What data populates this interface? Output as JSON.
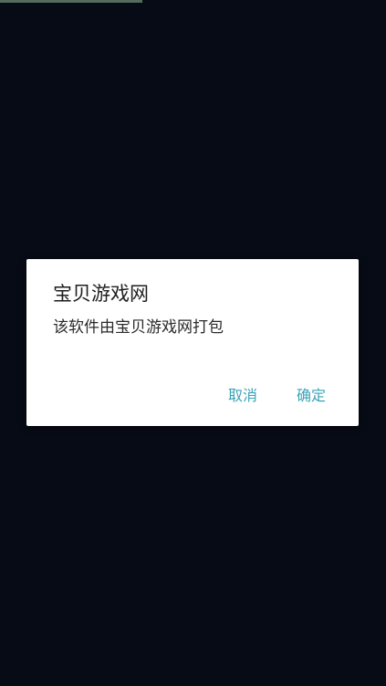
{
  "dialog": {
    "title": "宝贝游戏网",
    "message": "该软件由宝贝游戏网打包",
    "cancel_label": "取消",
    "confirm_label": "确定"
  },
  "colors": {
    "background": "#070b15",
    "dialog": "#ffffff",
    "accent": "#3aa3b8"
  }
}
